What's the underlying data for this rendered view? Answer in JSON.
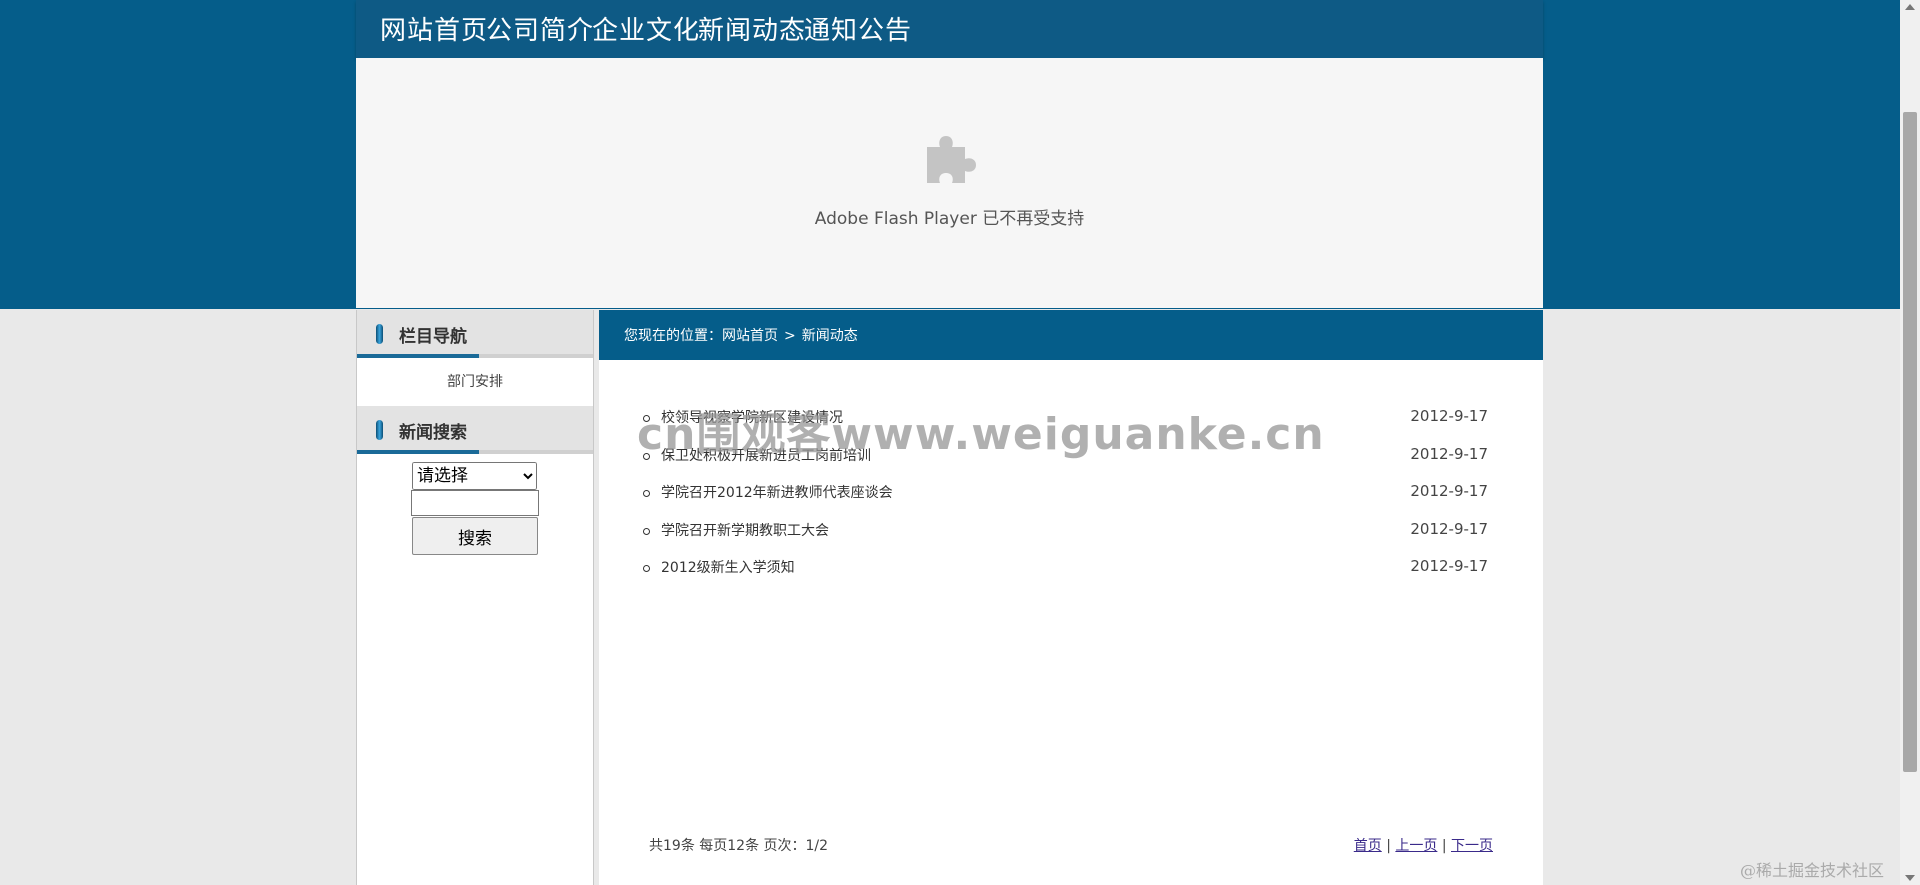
{
  "nav": {
    "items": [
      "网站首页",
      "公司简介",
      "企业文化",
      "新闻动态",
      "通知公告"
    ]
  },
  "flash": {
    "icon": "puzzle-icon",
    "message": "Adobe Flash Player 已不再受支持"
  },
  "sidebar": {
    "nav_title": "栏目导航",
    "nav_items": [
      "部门安排"
    ],
    "search_title": "新闻搜索",
    "select_value": "请选择",
    "search_button": "搜索"
  },
  "main": {
    "breadcrumb_prefix": "您现在的位置：",
    "breadcrumb_home": "网站首页",
    "breadcrumb_sep": ">",
    "breadcrumb_current": "新闻动态",
    "news": [
      {
        "title": "校领导视察学院新区建设情况",
        "date": "2012-9-17"
      },
      {
        "title": "保卫处积极开展新进员工岗前培训",
        "date": "2012-9-17"
      },
      {
        "title": "学院召开2012年新进教师代表座谈会",
        "date": "2012-9-17"
      },
      {
        "title": "学院召开新学期教职工大会",
        "date": "2012-9-17"
      },
      {
        "title": "2012级新生入学须知",
        "date": "2012-9-17"
      }
    ],
    "pager_info": "共19条 每页12条 页次：1/2",
    "pager_first": "首页",
    "pager_prev": "上一页",
    "pager_next": "下一页",
    "pager_sep": "|"
  },
  "overlay": {
    "watermark": "cn围观客www.weiguanke.cn",
    "corner_mark": "@稀土掘金技术社区"
  },
  "colors": {
    "brand_blue": "#055d8a",
    "nav_blue": "#0e5a85",
    "page_bg": "#e9e9e9"
  }
}
